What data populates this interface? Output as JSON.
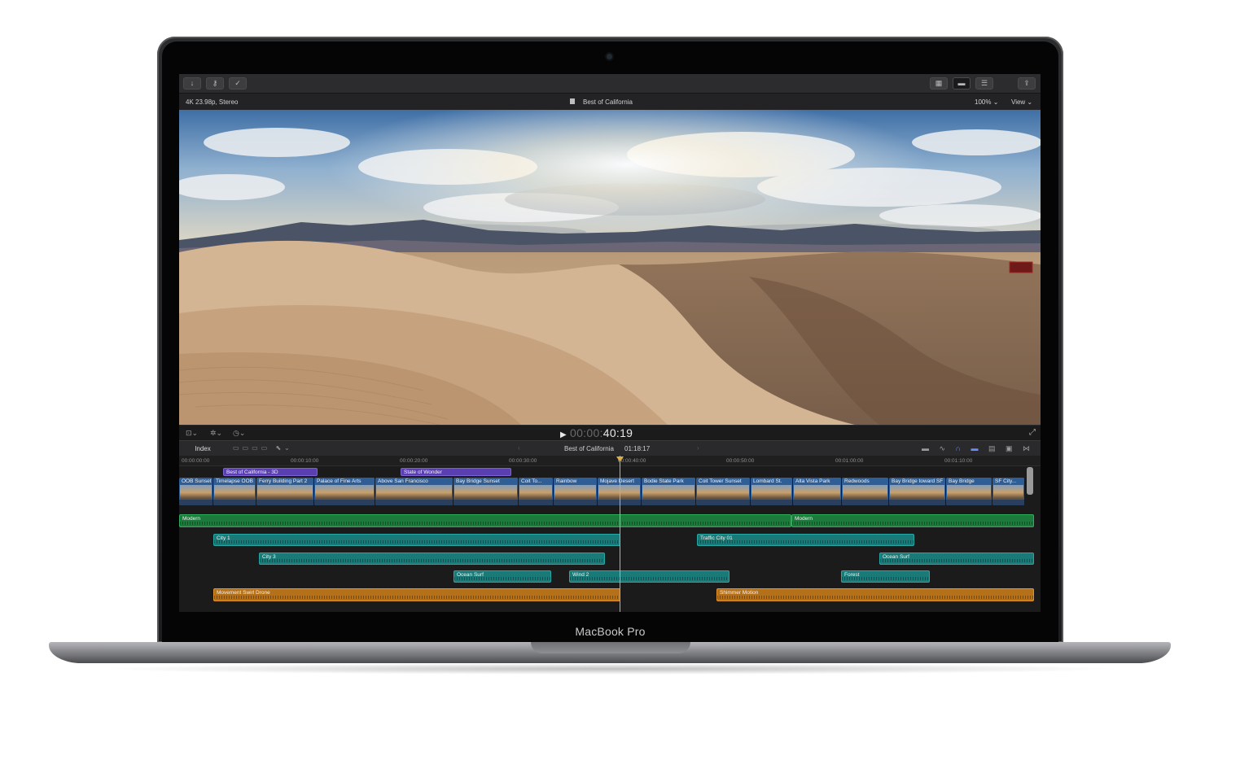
{
  "device": {
    "label": "MacBook Pro"
  },
  "toolbar": {
    "left_buttons": [
      "import-icon",
      "keyword-icon",
      "background-tasks-icon"
    ],
    "right_buttons": [
      "browser-toggle-icon",
      "timeline-toggle-icon",
      "inspector-toggle-icon",
      "share-icon"
    ]
  },
  "viewer": {
    "format": "4K 23.98p, Stereo",
    "project_title": "Best of California",
    "zoom": "100%",
    "view_menu": "View"
  },
  "transport": {
    "timecode_dim": "00:00:",
    "timecode": "40:19"
  },
  "timeline": {
    "index_button": "Index",
    "project_title": "Best of California",
    "duration": "01:18:17",
    "ruler": [
      "00:00:00:00",
      "00:00:10:00",
      "00:00:20:00",
      "00:00:30:00",
      "00:00:40:00",
      "00:00:50:00",
      "00:01:00:00",
      "00:01:10:00"
    ],
    "titles": [
      {
        "label": "Best of California - 3D"
      },
      {
        "label": "State of Wonder"
      }
    ],
    "video_clips": [
      {
        "label": "OOB Sunset"
      },
      {
        "label": "Timelapse OOB"
      },
      {
        "label": "Ferry Building Part 2"
      },
      {
        "label": "Palace of Fine Arts"
      },
      {
        "label": "Above San Francisco"
      },
      {
        "label": "Bay Bridge Sunset"
      },
      {
        "label": "Coit To..."
      },
      {
        "label": "Rainbow"
      },
      {
        "label": "Mojave Desert"
      },
      {
        "label": "Bodie State Park"
      },
      {
        "label": "Coit Tower Sunset"
      },
      {
        "label": "Lombard St."
      },
      {
        "label": "Alta Vista Park"
      },
      {
        "label": "Redwoods"
      },
      {
        "label": "Bay Bridge toward SF"
      },
      {
        "label": "Bay Bridge"
      },
      {
        "label": "SF City..."
      }
    ],
    "music_clips": [
      {
        "label": "Modern"
      },
      {
        "label": "Modern"
      }
    ],
    "audio_clips": [
      {
        "label": "City 1"
      },
      {
        "label": "Traffic City 01"
      },
      {
        "label": "City 3"
      },
      {
        "label": "Ocean Surf"
      },
      {
        "label": "Ocean Surf"
      },
      {
        "label": "Wind 2"
      },
      {
        "label": "Forest"
      }
    ],
    "fx_clips": [
      {
        "label": "Movement Swirl Drone"
      },
      {
        "label": "Shimmer Motion"
      }
    ]
  },
  "colors": {
    "title_clip": "#5a3fb0",
    "video_clip": "#2f5e96",
    "music_clip": "#1c7a3c",
    "audio_clip": "#1a7a78",
    "fx_clip": "#b5701a",
    "playhead": "#d8b04a"
  }
}
